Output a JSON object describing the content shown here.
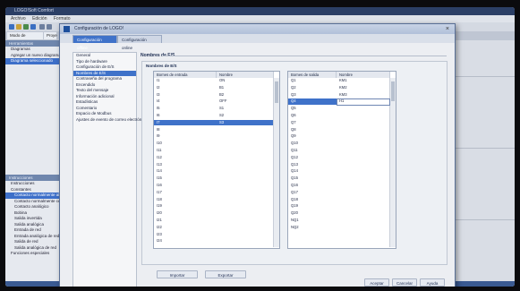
{
  "app": {
    "title": "LOGO!Soft Comfort",
    "menu": [
      "Archivo",
      "Edición",
      "Formato"
    ],
    "tabs": [
      "Modo de diagrama",
      "Proye"
    ],
    "left_panel": {
      "header": "Herramientas",
      "tree_top": [
        "Diagramas",
        "Agregar un nuevo diagrama",
        "Diagrama seleccionado"
      ],
      "lower_header": "Instrucciones",
      "tree_lower": [
        "Instrucciones",
        "Constantes",
        "Contacto normalmente abierto",
        "Contacto normalmente cerrado",
        "Contacto analógico",
        "Bobina",
        "Salida invertida",
        "Salida analógica",
        "Entrada de red",
        "Entrada analógica de red",
        "Salida de red",
        "Salida analógica de red",
        "Funciones especiales"
      ]
    }
  },
  "dialog": {
    "title": "Configuración de LOGO!",
    "close_symbol": "×",
    "tabs": [
      "Configuración offline",
      "Configuración online"
    ],
    "nav_items": [
      "General",
      "Tipo de hardware",
      "Configuración de E/S",
      "Nombres de E/S",
      "Contraseña del programa",
      "Encendido",
      "Texto del mensaje",
      "Información adicional",
      "Estadísticas",
      "Comentario",
      "Espacio de Modbus",
      "Ajustes de evento de correo electrónico"
    ],
    "section_title": "Nombres de E/S",
    "group_title": "Nombres de E/S",
    "inputs_table": {
      "headers": [
        "Bornes de entrada",
        "Nombre"
      ],
      "rows": [
        {
          "terminal": "I1",
          "name": "ON"
        },
        {
          "terminal": "I2",
          "name": "B1"
        },
        {
          "terminal": "I3",
          "name": "B2"
        },
        {
          "terminal": "I4",
          "name": "OFF"
        },
        {
          "terminal": "I5",
          "name": "S1"
        },
        {
          "terminal": "I6",
          "name": "S2"
        },
        {
          "terminal": "I7",
          "name": "S3"
        },
        {
          "terminal": "I8",
          "name": ""
        },
        {
          "terminal": "I9",
          "name": ""
        },
        {
          "terminal": "I10",
          "name": ""
        },
        {
          "terminal": "I11",
          "name": ""
        },
        {
          "terminal": "I12",
          "name": ""
        },
        {
          "terminal": "I13",
          "name": ""
        },
        {
          "terminal": "I14",
          "name": ""
        },
        {
          "terminal": "I15",
          "name": ""
        },
        {
          "terminal": "I16",
          "name": ""
        },
        {
          "terminal": "I17",
          "name": ""
        },
        {
          "terminal": "I18",
          "name": ""
        },
        {
          "terminal": "I19",
          "name": ""
        },
        {
          "terminal": "I20",
          "name": ""
        },
        {
          "terminal": "I21",
          "name": ""
        },
        {
          "terminal": "I22",
          "name": ""
        },
        {
          "terminal": "I23",
          "name": ""
        },
        {
          "terminal": "I24",
          "name": ""
        }
      ]
    },
    "outputs_table": {
      "headers": [
        "Bornes de salida",
        "Nombre"
      ],
      "rows": [
        {
          "terminal": "Q1",
          "name": "KM1"
        },
        {
          "terminal": "Q2",
          "name": "KM2"
        },
        {
          "terminal": "Q3",
          "name": "KM3"
        },
        {
          "terminal": "Q4",
          "name": "H1"
        },
        {
          "terminal": "Q5",
          "name": ""
        },
        {
          "terminal": "Q6",
          "name": ""
        },
        {
          "terminal": "Q7",
          "name": ""
        },
        {
          "terminal": "Q8",
          "name": ""
        },
        {
          "terminal": "Q9",
          "name": ""
        },
        {
          "terminal": "Q10",
          "name": ""
        },
        {
          "terminal": "Q11",
          "name": ""
        },
        {
          "terminal": "Q12",
          "name": ""
        },
        {
          "terminal": "Q13",
          "name": ""
        },
        {
          "terminal": "Q14",
          "name": ""
        },
        {
          "terminal": "Q15",
          "name": ""
        },
        {
          "terminal": "Q16",
          "name": ""
        },
        {
          "terminal": "Q17",
          "name": ""
        },
        {
          "terminal": "Q18",
          "name": ""
        },
        {
          "terminal": "Q19",
          "name": ""
        },
        {
          "terminal": "Q20",
          "name": ""
        },
        {
          "terminal": "NQ1",
          "name": ""
        },
        {
          "terminal": "NQ2",
          "name": ""
        }
      ]
    },
    "import_button": "Importar",
    "export_button": "Exportar",
    "accept_button": "Aceptar",
    "cancel_button": "Cancelar",
    "help_button": "Ayuda"
  }
}
